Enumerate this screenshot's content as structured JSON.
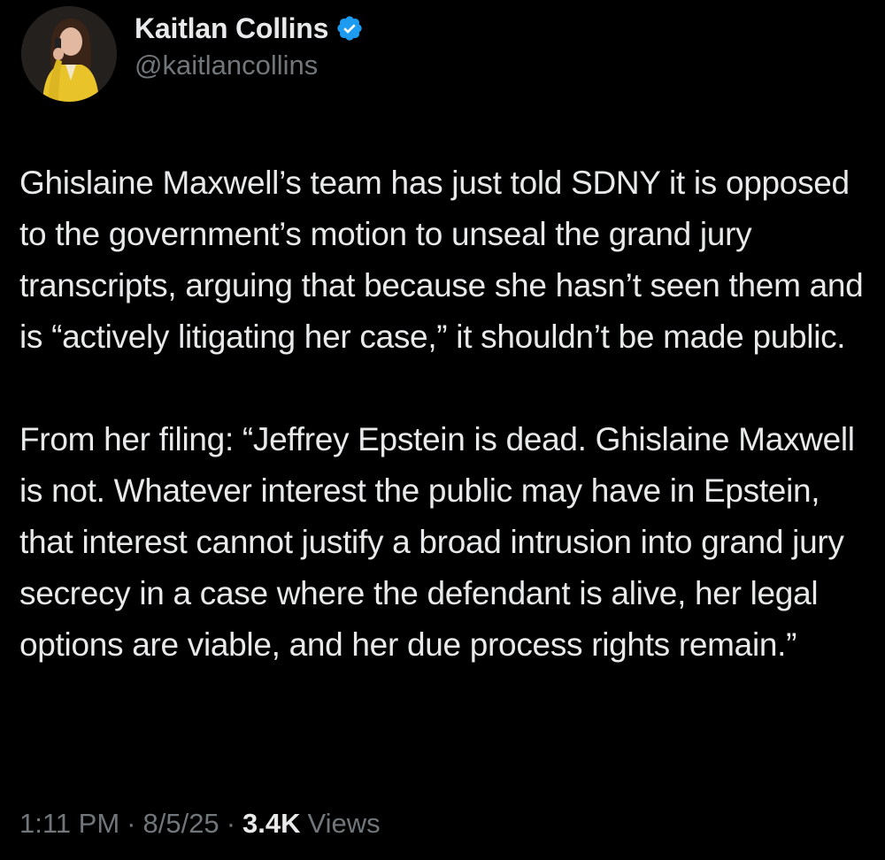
{
  "author": {
    "display_name": "Kaitlan Collins",
    "handle": "@kaitlancollins",
    "verified_icon": "verified-badge-icon",
    "avatar": "profile-photo"
  },
  "tweet": {
    "paragraphs": [
      "Ghislaine Maxwell’s team has just told SDNY it is opposed to the government’s motion to unseal the grand jury transcripts, arguing that because she hasn’t seen them and is “actively litigating her case,” it shouldn’t be made public.",
      "From her filing: “Jeffrey Epstein is dead. Ghislaine Maxwell is not. Whatever interest the public may have in Epstein, that interest cannot justify a broad intrusion into grand jury secrecy in a case where the defendant is alive, her legal options are viable, and her due process rights remain.”"
    ]
  },
  "meta": {
    "time": "1:11 PM",
    "separator": "·",
    "date": "8/5/25",
    "views_count": "3.4K",
    "views_label": "Views"
  },
  "colors": {
    "background": "#000000",
    "text_primary": "#e7e9ea",
    "text_secondary": "#71767b",
    "verified_blue": "#1d9bf0"
  }
}
